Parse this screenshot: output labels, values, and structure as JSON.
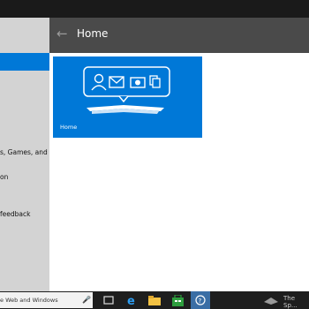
{
  "window": {
    "title": "Home"
  },
  "sidebar": {
    "items": [
      {
        "label": "s, Games, and"
      },
      {
        "label": "on"
      },
      {
        "label": "feedback"
      }
    ]
  },
  "tile": {
    "label": "Home"
  },
  "taskbar": {
    "search_placeholder": "e Web and Windows",
    "tray_text": "The Sp..."
  },
  "colors": {
    "accent": "#0078d7",
    "sidebar": "#d3d3d3",
    "header": "#4a4a4a",
    "taskbar": "#1e1e1e"
  }
}
